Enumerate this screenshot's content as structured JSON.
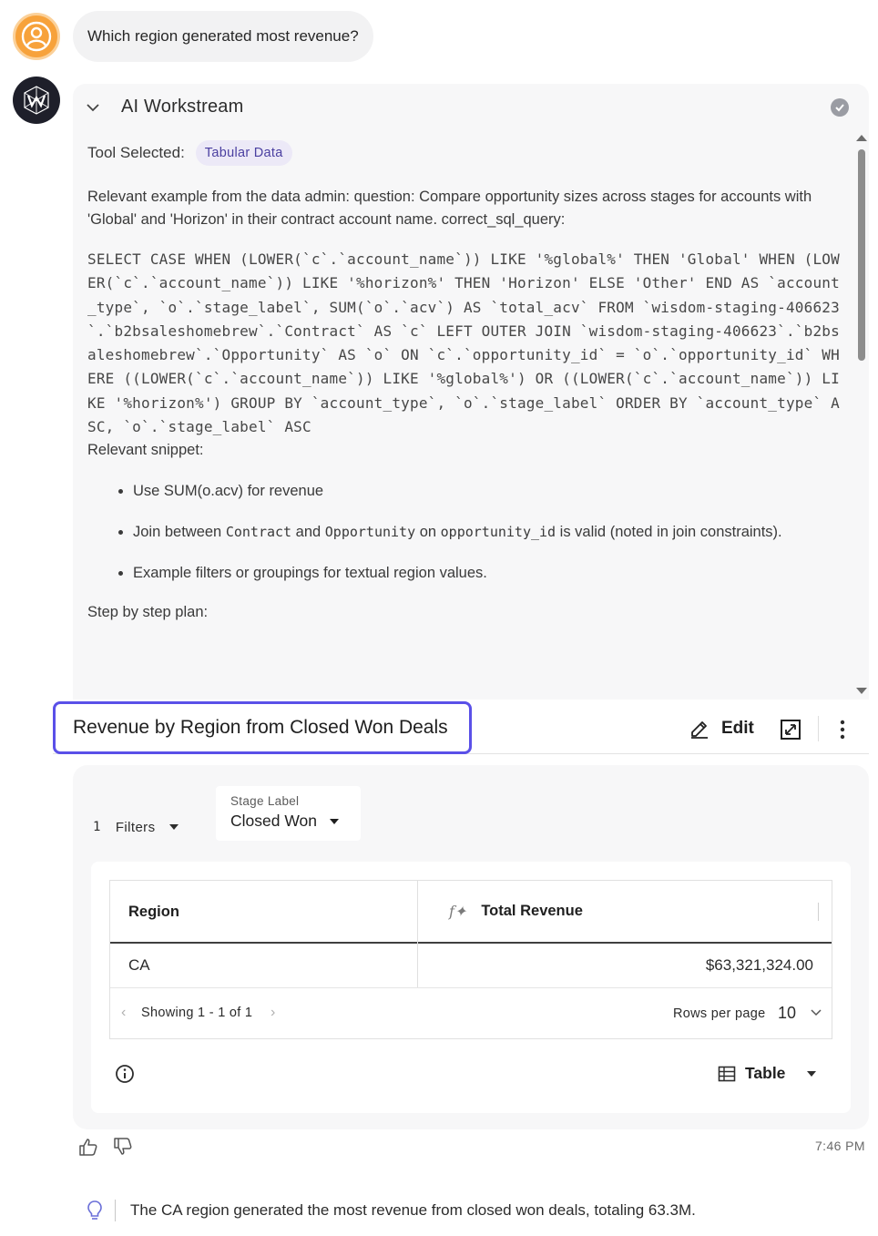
{
  "user": {
    "question": "Which region generated most revenue?"
  },
  "workstream": {
    "title": "AI Workstream",
    "tool_label": "Tool Selected:",
    "tool_value": "Tabular Data",
    "example_text": "Relevant example from the data admin: question: Compare opportunity sizes across stages for accounts with 'Global' and 'Horizon' in their contract account name. correct_sql_query:",
    "sql": "SELECT CASE WHEN (LOWER(`c`.`account_name`)) LIKE '%global%' THEN 'Global' WHEN (LOWER(`c`.`account_name`)) LIKE '%horizon%' THEN 'Horizon' ELSE 'Other' END AS `account_type`, `o`.`stage_label`, SUM(`o`.`acv`) AS `total_acv` FROM `wisdom-staging-406623`.`b2bsaleshomebrew`.`Contract` AS `c` LEFT OUTER JOIN `wisdom-staging-406623`.`b2bsaleshomebrew`.`Opportunity` AS `o` ON `c`.`opportunity_id` = `o`.`opportunity_id` WHERE ((LOWER(`c`.`account_name`)) LIKE '%global%') OR ((LOWER(`c`.`account_name`)) LIKE '%horizon%') GROUP BY `account_type`, `o`.`stage_label` ORDER BY `account_type` ASC, `o`.`stage_label` ASC",
    "snippet_label": "Relevant snippet:",
    "bullet1": "Use SUM(o.acv) for revenue",
    "bullet2_a": "Join between ",
    "bullet2_m1": "Contract",
    "bullet2_b": " and ",
    "bullet2_m2": "Opportunity",
    "bullet2_c": " on ",
    "bullet2_m3": "opportunity_id",
    "bullet2_d": " is valid (noted in join constraints).",
    "bullet3": "Example filters or groupings for textual region values.",
    "plan_label": "Step by step plan:"
  },
  "result": {
    "title": "Revenue by Region from Closed Won Deals",
    "edit_label": "Edit",
    "filters_count": "1",
    "filters_label": "Filters",
    "stage_filter_label": "Stage Label",
    "stage_filter_value": "Closed Won",
    "columns": [
      "Region",
      "Total Revenue"
    ],
    "rows": [
      {
        "region": "CA",
        "total_revenue": "$63,321,324.00"
      }
    ],
    "showing_text": "Showing 1 - 1 of 1",
    "rows_per_page_label": "Rows per page",
    "rows_per_page_value": "10",
    "view_label": "Table"
  },
  "timestamp": "7:46 PM",
  "summary": "The CA region generated the most revenue from closed won deals, totaling 63.3M.",
  "colors": {
    "accent": "#5a50e8",
    "user_avatar": "#f7a23b",
    "bot_avatar": "#1e1f2a",
    "pill_bg": "#ece9f7",
    "pill_text": "#4a3fa0"
  }
}
